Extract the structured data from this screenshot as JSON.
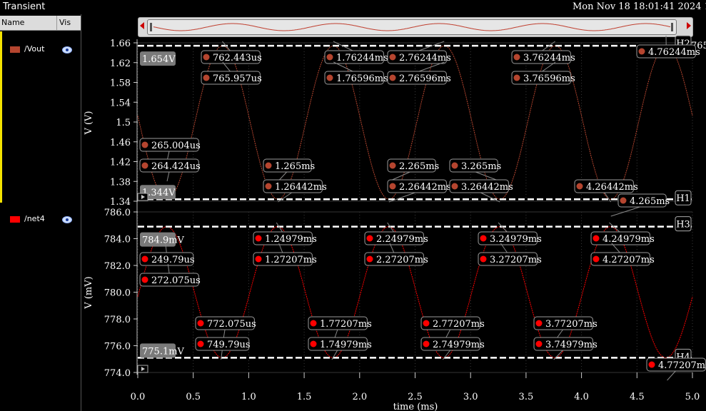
{
  "window": {
    "title": "Transient",
    "datetime": "Mon Nov 18 18:01:41 2024 1"
  },
  "sidebar": {
    "col_name": "Name",
    "col_vis": "Vis",
    "signals": [
      {
        "label": "/Vout",
        "color": "#b5452f"
      },
      {
        "label": "/net4",
        "color": "#ff0000"
      }
    ]
  },
  "panels": [
    {
      "ylabel": "V (V)",
      "yticks": [
        "1.66",
        "1.62",
        "1.58",
        "1.54",
        "1.5",
        "1.46",
        "1.42",
        "1.38",
        "1.34"
      ],
      "top_badge": "1.654V",
      "bottom_badge": "1.344V",
      "cursor_top": "H2",
      "cursor_top_extra": "765",
      "cursor_bottom": "H1",
      "markers": [
        "762.443us",
        "765.957us",
        "1.76244ms",
        "1.76596ms",
        "2.76244ms",
        "2.76596ms",
        "3.76244ms",
        "3.76596ms",
        "4.76244ms",
        "265.004us",
        "264.424us",
        "1.265ms",
        "1.26442ms",
        "2.265ms",
        "2.26442ms",
        "3.265ms",
        "3.26442ms",
        "4.26442ms",
        "4.265ms"
      ]
    },
    {
      "ylabel": "V (mV)",
      "yticks": [
        "786.0",
        "784.0",
        "782.0",
        "780.0",
        "778.0",
        "776.0",
        "774.0"
      ],
      "top_badge": "784.9mV",
      "bottom_badge": "775.1mV",
      "cursor_top": "H3",
      "cursor_bottom": "H4",
      "markers": [
        "249.79us",
        "272.075us",
        "1.24979ms",
        "1.27207ms",
        "2.24979ms",
        "2.27207ms",
        "3.24979ms",
        "3.27207ms",
        "4.24979ms",
        "4.27207ms",
        "772.075us",
        "749.79us",
        "1.77207ms",
        "1.74979ms",
        "2.77207ms",
        "2.74979ms",
        "3.77207ms",
        "3.74979ms",
        "4.77207ms"
      ]
    }
  ],
  "xaxis": {
    "label": "time (ms)",
    "ticks": [
      "0.0",
      "0.5",
      "1.0",
      "1.5",
      "2.0",
      "2.5",
      "3.0",
      "3.5",
      "4.0",
      "4.5",
      "5.0"
    ]
  },
  "chart_data": [
    {
      "type": "line",
      "title": "",
      "xlabel": "time (ms)",
      "ylabel": "V (V)",
      "xlim": [
        0,
        5
      ],
      "ylim": [
        1.34,
        1.66
      ],
      "series": [
        {
          "name": "/Vout",
          "color": "#b5452f",
          "waveform": "sine",
          "period_ms": 1.0,
          "min": 1.344,
          "max": 1.654,
          "peak_at_ms": 0.764
        }
      ],
      "cursors": [
        {
          "name": "H2",
          "value": 1.654
        },
        {
          "name": "H1",
          "value": 1.344
        }
      ]
    },
    {
      "type": "line",
      "title": "",
      "xlabel": "time (ms)",
      "ylabel": "V (mV)",
      "xlim": [
        0,
        5
      ],
      "ylim": [
        774,
        786
      ],
      "series": [
        {
          "name": "/net4",
          "color": "#ff0000",
          "waveform": "sine",
          "period_ms": 1.0,
          "min": 775.1,
          "max": 784.9,
          "peak_at_ms": 0.261
        }
      ],
      "cursors": [
        {
          "name": "H3",
          "value": 784.9
        },
        {
          "name": "H4",
          "value": 775.1
        }
      ]
    }
  ]
}
